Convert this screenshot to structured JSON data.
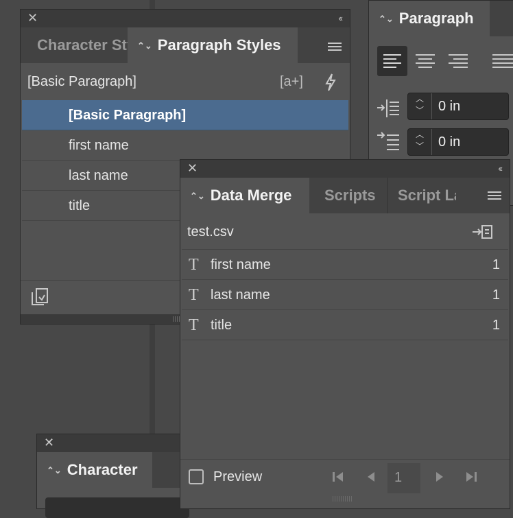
{
  "paragraph_styles_panel": {
    "tabs": [
      {
        "label": "Character Styles"
      },
      {
        "label": "Paragraph Styles"
      }
    ],
    "current_style": "[Basic Paragraph]",
    "styles": [
      {
        "label": "[Basic Paragraph]"
      },
      {
        "label": "first name"
      },
      {
        "label": "last name"
      },
      {
        "label": "title"
      }
    ],
    "new_style_icon": "[a+]"
  },
  "paragraph_panel": {
    "tab_label": "Paragraph",
    "left_indent": "0 in",
    "right_indent": "0 in"
  },
  "data_merge_panel": {
    "tabs": [
      {
        "label": "Data Merge"
      },
      {
        "label": "Scripts"
      },
      {
        "label": "Script Label"
      }
    ],
    "source_file": "test.csv",
    "fields": [
      {
        "name": "first name",
        "count": "1"
      },
      {
        "name": "last name",
        "count": "1"
      },
      {
        "name": "title",
        "count": "1"
      }
    ],
    "preview_label": "Preview",
    "page_number": "1"
  },
  "character_panel": {
    "tab_label": "Character"
  },
  "colors": {
    "panel_bg": "#535353",
    "selected_row": "#4b6b8f",
    "titlebar": "#3a3a3a"
  }
}
